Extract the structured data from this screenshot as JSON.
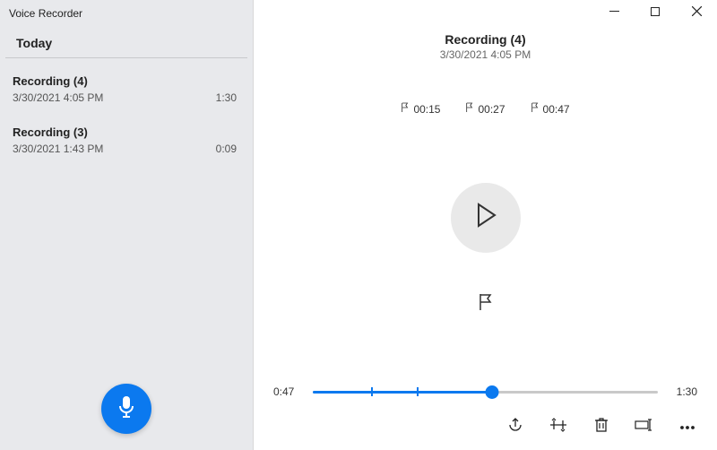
{
  "app_title": "Voice Recorder",
  "sidebar": {
    "section": "Today",
    "items": [
      {
        "title": "Recording (4)",
        "timestamp": "3/30/2021 4:05 PM",
        "duration": "1:30"
      },
      {
        "title": "Recording (3)",
        "timestamp": "3/30/2021 1:43 PM",
        "duration": "0:09"
      }
    ]
  },
  "detail": {
    "title": "Recording (4)",
    "timestamp": "3/30/2021 4:05 PM",
    "markers": [
      {
        "t": "00:15"
      },
      {
        "t": "00:27"
      },
      {
        "t": "00:47"
      }
    ],
    "playhead_time": "0:47",
    "total_time": "1:30",
    "progress_pct": 52,
    "marker_pct": [
      17,
      30,
      52
    ]
  }
}
